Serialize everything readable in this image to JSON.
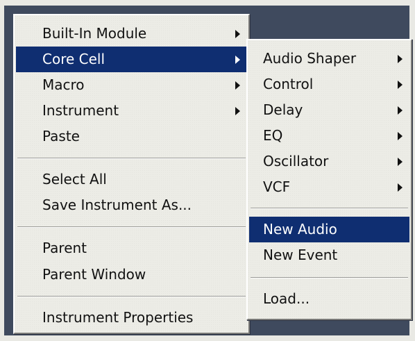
{
  "main_menu": {
    "items": [
      {
        "label": "Built-In Module",
        "submenu": true
      },
      {
        "label": "Core Cell",
        "submenu": true,
        "highlighted": true
      },
      {
        "label": "Macro",
        "submenu": true
      },
      {
        "label": "Instrument",
        "submenu": true
      },
      {
        "label": "Paste"
      },
      {
        "label": "Select All"
      },
      {
        "label": "Save Instrument As..."
      },
      {
        "label": "Parent"
      },
      {
        "label": "Parent Window"
      },
      {
        "label": "Instrument Properties"
      }
    ]
  },
  "sub_menu": {
    "items": [
      {
        "label": "Audio Shaper",
        "submenu": true
      },
      {
        "label": "Control",
        "submenu": true
      },
      {
        "label": "Delay",
        "submenu": true
      },
      {
        "label": "EQ",
        "submenu": true
      },
      {
        "label": "Oscillator",
        "submenu": true
      },
      {
        "label": "VCF",
        "submenu": true
      },
      {
        "label": "New Audio",
        "highlighted": true
      },
      {
        "label": "New Event"
      },
      {
        "label": "Load..."
      }
    ]
  },
  "colors": {
    "highlight": "#0f2e71",
    "menu_bg": "#ecece6",
    "backdrop": "#3f4a5e"
  }
}
